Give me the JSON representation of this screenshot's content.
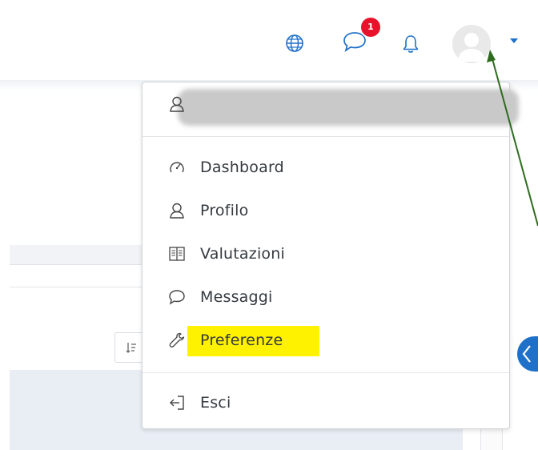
{
  "navbar": {
    "language_icon": "globe-icon",
    "messages_icon": "chat-bubble-icon",
    "messages_badge": "1",
    "notifications_icon": "bell-icon",
    "user_avatar": "avatar",
    "user_menu_caret": "caret-down-icon"
  },
  "user_menu": {
    "user_icon": "user-icon",
    "items": [
      {
        "label": "Dashboard",
        "icon": "gauge-icon"
      },
      {
        "label": "Profilo",
        "icon": "user-icon"
      },
      {
        "label": "Valutazioni",
        "icon": "book-icon"
      },
      {
        "label": "Messaggi",
        "icon": "chat-bubble-icon"
      },
      {
        "label": "Preferenze",
        "icon": "wrench-icon",
        "highlighted": true
      },
      {
        "label": "Esci",
        "icon": "sign-out-icon"
      }
    ]
  },
  "colors": {
    "accent": "#1f70c8",
    "badge": "#e8132b",
    "highlight": "#fff200",
    "annotation_arrow": "#2e6b1f"
  }
}
